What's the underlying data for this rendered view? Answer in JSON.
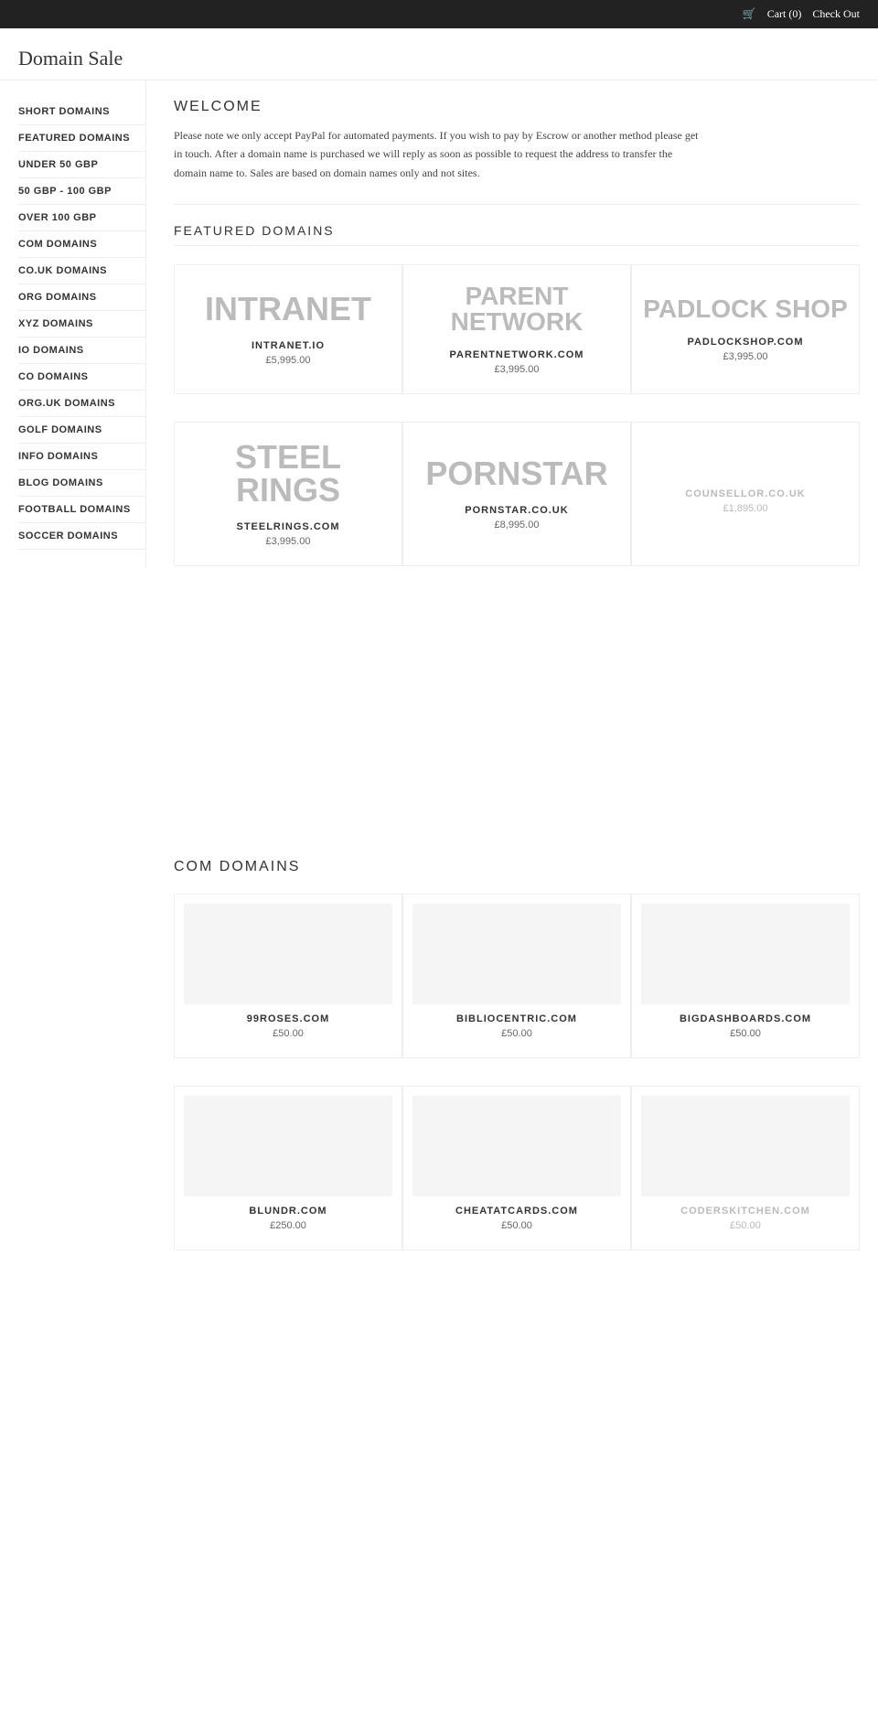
{
  "topbar": {
    "cart_label": "Cart (0)",
    "checkout_label": "Check Out",
    "cart_icon": "🛒"
  },
  "header": {
    "page_title": "Domain Sale"
  },
  "sidebar": {
    "items": [
      {
        "id": "short-domains",
        "label": "SHORT DOMAINS"
      },
      {
        "id": "featured-domains",
        "label": "FEATURED DOMAINS"
      },
      {
        "id": "under-50",
        "label": "UNDER 50 GBP"
      },
      {
        "id": "50-100",
        "label": "50 GBP - 100 GBP"
      },
      {
        "id": "over-100",
        "label": "OVER 100 GBP"
      },
      {
        "id": "com-domains",
        "label": "COM DOMAINS"
      },
      {
        "id": "couk-domains",
        "label": "CO.UK DOMAINS"
      },
      {
        "id": "org-domains",
        "label": "ORG DOMAINS"
      },
      {
        "id": "xyz-domains",
        "label": "XYZ DOMAINS"
      },
      {
        "id": "io-domains",
        "label": "IO DOMAINS"
      },
      {
        "id": "co-domains",
        "label": "CO DOMAINS"
      },
      {
        "id": "orguk-domains",
        "label": "ORG.UK DOMAINS"
      },
      {
        "id": "golf-domains",
        "label": "GOLF DOMAINS"
      },
      {
        "id": "info-domains",
        "label": "INFO DOMAINS"
      },
      {
        "id": "blog-domains",
        "label": "BLOG DOMAINS"
      },
      {
        "id": "football-domains",
        "label": "FOOTBALL DOMAINS"
      },
      {
        "id": "soccer-domains",
        "label": "SOCCER DOMAINS"
      }
    ]
  },
  "welcome": {
    "title": "WELCOME",
    "text": "Please note we only accept PayPal for automated payments. If you wish to pay by Escrow or another method please get in touch. After a domain name is purchased we will reply as soon as possible to request the address to transfer the domain name to. Sales are based on domain names only and not sites."
  },
  "featured": {
    "section_title": "FEATURED DOMAINS",
    "row1": [
      {
        "logo_text": "INTRANET",
        "logo_size": "large",
        "name": "INTRANET.IO",
        "price": "£5,995.00",
        "greyed": false
      },
      {
        "logo_text": "PARENT NETWORK",
        "logo_size": "medium",
        "name": "PARENTNETWORK.COM",
        "price": "£3,995.00",
        "greyed": false
      },
      {
        "logo_text": "PADLOCK SHOP",
        "logo_size": "medium",
        "name": "PADLOCKSHOP.COM",
        "price": "£3,995.00",
        "greyed": false
      }
    ],
    "row2": [
      {
        "logo_text": "STEEL RINGS",
        "logo_size": "large",
        "name": "STEELRINGS.COM",
        "price": "£3,995.00",
        "greyed": false
      },
      {
        "logo_text": "PORNSTAR",
        "logo_size": "large",
        "name": "PORNSTAR.CO.UK",
        "price": "£8,995.00",
        "greyed": false
      },
      {
        "logo_text": "",
        "logo_size": "large",
        "name": "COUNSELLOR.CO.UK",
        "price": "£1,895.00",
        "greyed": true
      }
    ]
  },
  "com_domains": {
    "section_title": "COM DOMAINS",
    "row1": [
      {
        "name": "99ROSES.COM",
        "price": "£50.00",
        "greyed": false
      },
      {
        "name": "BIBLIOCENTRIC.COM",
        "price": "£50.00",
        "greyed": false
      },
      {
        "name": "BIGDASHBOARDS.COM",
        "price": "£50.00",
        "greyed": false
      }
    ],
    "row2": [
      {
        "name": "BLUNDR.COM",
        "price": "£250.00",
        "greyed": false
      },
      {
        "name": "CHEATATCARDS.COM",
        "price": "£50.00",
        "greyed": false
      },
      {
        "name": "CODERSKITCHEN.COM",
        "price": "£50.00",
        "greyed": true
      }
    ]
  }
}
